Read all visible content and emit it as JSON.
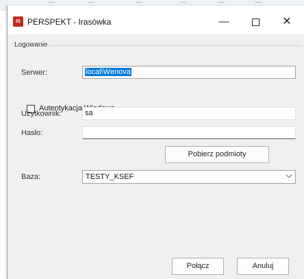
{
  "window": {
    "app_icon_text": "IS",
    "title": "PERSPEKT - Irasówka",
    "minimize_label": "—",
    "close_label": "✕"
  },
  "group": {
    "label": "Logowanie"
  },
  "server": {
    "label": "Serwer:",
    "value": "local\\Wenova"
  },
  "windows_auth": {
    "label": "Autentykacja Windows",
    "checked": false
  },
  "user": {
    "label": "Użytkownik:",
    "value": "sa"
  },
  "password": {
    "label": "Hasło:",
    "value": ""
  },
  "fetch_button": {
    "label": "Pobierz podmioty"
  },
  "database": {
    "label": "Baza:",
    "value": "TESTY_KSEF"
  },
  "footer": {
    "connect_label": "Połącz",
    "cancel_label": "Anuluj"
  }
}
